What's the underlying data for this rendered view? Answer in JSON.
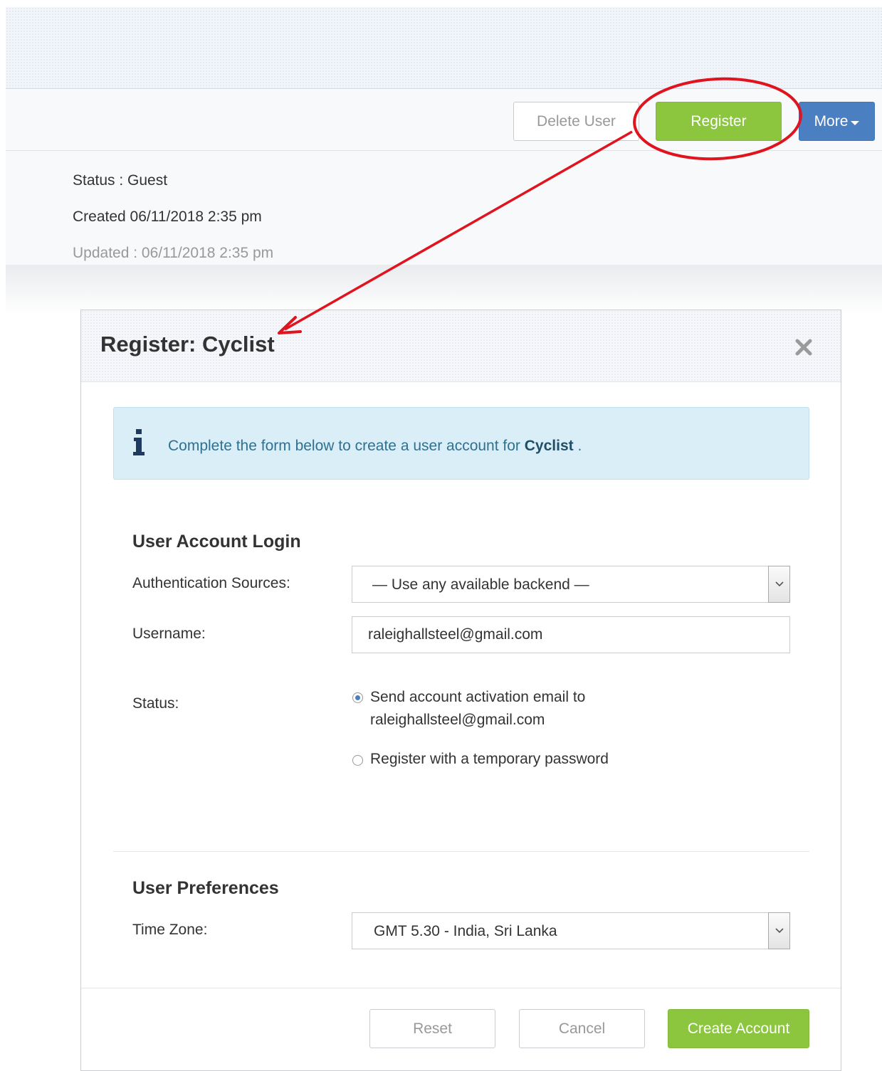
{
  "toolbar": {
    "delete_label": "Delete User",
    "register_label": "Register",
    "more_label": "More"
  },
  "user_info": {
    "status": "Status : Guest",
    "created": "Created 06/11/2018 2:35 pm",
    "updated": "Updated : 06/11/2018 2:35 pm"
  },
  "modal": {
    "title": "Register: Cyclist",
    "alert": {
      "text_before": "Complete the form below to create a user account for ",
      "text_bold": "Cyclist",
      "text_after": " ."
    },
    "login_section": {
      "title": "User Account Login",
      "auth_label": "Authentication Sources:",
      "auth_value": "— Use any available backend —",
      "username_label": "Username:",
      "username_value": "raleighallsteel@gmail.com",
      "status_label": "Status:",
      "status_options": [
        {
          "line1": "Send account activation email to",
          "line2": "raleighallsteel@gmail.com",
          "checked": true
        },
        {
          "line1": "Register with a temporary password",
          "checked": false
        }
      ]
    },
    "preferences_section": {
      "title": "User Preferences",
      "timezone_label": "Time Zone:",
      "timezone_value": "GMT 5.30 - India, Sri Lanka"
    },
    "buttons": {
      "reset": "Reset",
      "cancel": "Cancel",
      "create": "Create Account"
    }
  },
  "colors": {
    "accent_green": "#8cc63f",
    "accent_blue": "#4a7fc1",
    "annotation_red": "#e0141e",
    "alert_bg": "#d9eef7"
  }
}
